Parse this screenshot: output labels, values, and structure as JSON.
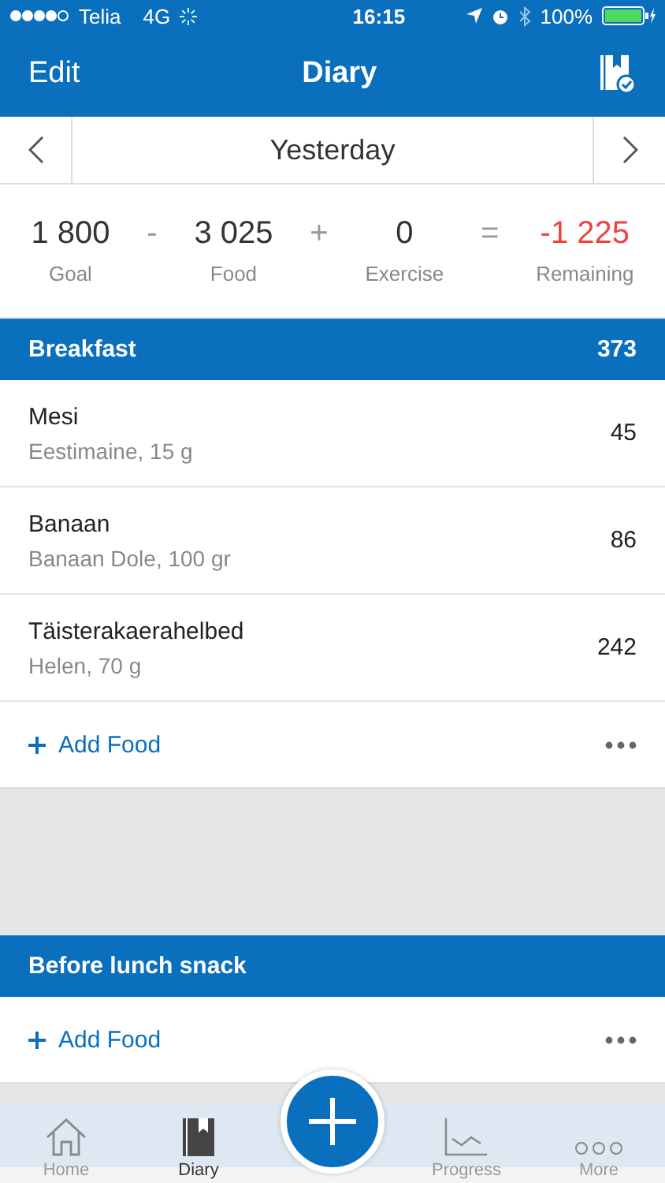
{
  "status_bar": {
    "carrier": "Telia",
    "network": "4G",
    "time": "16:15",
    "battery": "100%"
  },
  "nav": {
    "left": "Edit",
    "title": "Diary"
  },
  "date": {
    "label": "Yesterday"
  },
  "summary": [
    {
      "kind": "term",
      "value": "1 800",
      "label": "Goal",
      "negative": false
    },
    {
      "kind": "operator",
      "symbol": "-"
    },
    {
      "kind": "term",
      "value": "3 025",
      "label": "Food",
      "negative": false
    },
    {
      "kind": "operator",
      "symbol": "+"
    },
    {
      "kind": "term",
      "value": "0",
      "label": "Exercise",
      "negative": false
    },
    {
      "kind": "operator",
      "symbol": "="
    },
    {
      "kind": "term",
      "value": "-1 225",
      "label": "Remaining",
      "negative": true
    }
  ],
  "meals": [
    {
      "name": "Breakfast",
      "calories": "373",
      "add_label": "Add Food",
      "items": [
        {
          "name": "Mesi",
          "detail": "Eestimaine, 15 g",
          "calories": "45"
        },
        {
          "name": "Banaan",
          "detail": "Banaan Dole, 100 gr",
          "calories": "86"
        },
        {
          "name": "Täisterakaerahelbed",
          "detail": "Helen, 70 g",
          "calories": "242"
        }
      ]
    },
    {
      "name": "Before lunch snack",
      "add_label": "Add Food"
    }
  ],
  "tabs": [
    {
      "kind": "home",
      "label": "Home",
      "selected": false
    },
    {
      "kind": "diary",
      "label": "Diary",
      "selected": true
    },
    {
      "kind": "add"
    },
    {
      "kind": "progress",
      "label": "Progress",
      "selected": false
    },
    {
      "kind": "more",
      "label": "More",
      "selected": false
    }
  ]
}
